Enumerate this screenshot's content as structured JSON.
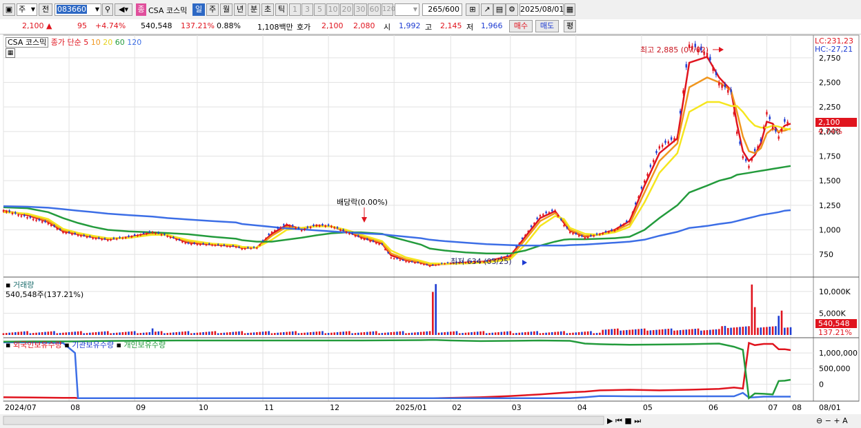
{
  "toolbar": {
    "type_label": "주",
    "prev_label": "전",
    "code": "083660",
    "category_badge": "종",
    "stock_name": "CSA 코스믹",
    "periods": [
      "일",
      "주",
      "월",
      "년",
      "분",
      "초",
      "틱"
    ],
    "active_period": "일",
    "minute_options": [
      "1",
      "3",
      "5",
      "10",
      "20",
      "30",
      "60",
      "120"
    ],
    "count": "265",
    "count_max": "/600",
    "date": "2025/08/01"
  },
  "quote": {
    "price": "2,100",
    "change": "95",
    "change_pct": "+4.74%",
    "volume": "540,548",
    "volume_ratio": "137.21%",
    "turnover": "0.88%",
    "amount": "1,108백만",
    "ask_label": "호가",
    "ask": "2,100",
    "bid": "2,080",
    "open_label": "시",
    "open": "1,992",
    "high_label": "고",
    "high": "2,145",
    "low_label": "저",
    "low": "1,966",
    "buy_label": "매수",
    "sell_label": "매도",
    "eval_label": "평"
  },
  "legend": {
    "stock_label": "CSA 코스믹",
    "ma_label": "종가 단순",
    "ma_periods": [
      {
        "period": "5",
        "color": "#e0141e"
      },
      {
        "period": "10",
        "color": "#f0961e"
      },
      {
        "period": "20",
        "color": "#f5e61e"
      },
      {
        "period": "60",
        "color": "#239b3c"
      },
      {
        "period": "120",
        "color": "#3c6ee6"
      }
    ],
    "volume_label": "거래량",
    "volume_value": "540,548주(137.21%)",
    "holding_labels": [
      "외국인보유수량",
      "기관보유수량",
      "개인보유수량"
    ],
    "lc": "LC:231,23",
    "hc": "HC:-27,21"
  },
  "annotations": {
    "high_text": "최고 2,885 (07/02)",
    "low_text": "최저 634 (03/25)",
    "dividend_text": "배당락(0.00%)",
    "price_tag": "2,100",
    "pct_tag": "4.74%",
    "vol_tag": "540,548",
    "vol_pct_tag": "137.21%"
  },
  "chart_data": [
    {
      "type": "line",
      "title": "CSA 코스믹 일봉",
      "x_ticks": [
        "2024/07",
        "08",
        "09",
        "10",
        "11",
        "12",
        "2025/01",
        "02",
        "03",
        "04",
        "05",
        "06",
        "07",
        "08"
      ],
      "x_tick_right": "08/01",
      "y_ticks": [
        "750",
        "1,000",
        "1,250",
        "1,500",
        "1,750",
        "2,000",
        "2,250",
        "2,500",
        "2,750"
      ],
      "ylim": [
        520,
        2980
      ],
      "x_index": [
        0,
        8,
        15,
        20,
        25,
        30,
        35,
        42,
        50,
        55,
        62,
        70,
        78,
        80,
        85,
        90,
        95,
        100,
        105,
        110,
        115,
        120,
        127,
        130,
        135,
        140,
        143,
        148,
        155,
        162,
        170,
        175,
        180,
        185,
        188,
        190,
        195,
        200,
        205,
        210,
        215,
        220,
        226,
        230,
        236,
        240,
        244,
        246,
        248,
        250,
        252,
        254,
        256,
        258,
        260,
        262,
        264
      ],
      "close": [
        1200,
        1130,
        1070,
        980,
        950,
        920,
        900,
        930,
        980,
        940,
        860,
        850,
        830,
        810,
        820,
        980,
        1060,
        1000,
        1050,
        1040,
        980,
        920,
        850,
        720,
        680,
        660,
        634,
        660,
        670,
        680,
        740,
        950,
        1150,
        1200,
        1050,
        980,
        920,
        960,
        1000,
        1100,
        1500,
        1850,
        1950,
        2885,
        2800,
        2500,
        2400,
        2000,
        1750,
        1650,
        1800,
        1900,
        2200,
        2050,
        1950,
        2100,
        2100
      ],
      "series": [
        {
          "name": "5",
          "values": [
            1195,
            1150,
            1080,
            985,
            955,
            925,
            905,
            925,
            970,
            945,
            870,
            850,
            835,
            815,
            820,
            960,
            1050,
            1010,
            1045,
            1035,
            985,
            925,
            860,
            740,
            690,
            665,
            640,
            655,
            668,
            680,
            735,
            930,
            1120,
            1190,
            1070,
            990,
            930,
            955,
            1000,
            1090,
            1450,
            1780,
            1930,
            2700,
            2760,
            2550,
            2420,
            2080,
            1800,
            1700,
            1760,
            1880,
            2100,
            2080,
            1990,
            2060,
            2080
          ]
        },
        {
          "name": "10",
          "values": [
            1190,
            1160,
            1090,
            995,
            960,
            930,
            910,
            920,
            960,
            950,
            880,
            855,
            840,
            820,
            818,
            940,
            1030,
            1020,
            1040,
            1035,
            990,
            935,
            870,
            760,
            700,
            670,
            648,
            652,
            662,
            676,
            720,
            900,
            1090,
            1170,
            1090,
            1000,
            940,
            950,
            990,
            1060,
            1380,
            1700,
            1880,
            2450,
            2550,
            2500,
            2420,
            2200,
            1950,
            1800,
            1780,
            1830,
            1980,
            2030,
            2000,
            2010,
            2030
          ]
        },
        {
          "name": "20",
          "values": [
            1180,
            1165,
            1110,
            1010,
            970,
            940,
            915,
            918,
            950,
            948,
            895,
            860,
            845,
            828,
            820,
            900,
            1000,
            1020,
            1035,
            1035,
            1000,
            950,
            885,
            790,
            720,
            685,
            660,
            655,
            658,
            668,
            700,
            850,
            1040,
            1140,
            1110,
            1020,
            960,
            950,
            975,
            1030,
            1280,
            1580,
            1780,
            2200,
            2300,
            2300,
            2260,
            2260,
            2200,
            2120,
            2060,
            2040,
            2040,
            2060,
            2050,
            2030,
            2020
          ]
        },
        {
          "name": "60",
          "values": [
            1230,
            1220,
            1180,
            1120,
            1070,
            1030,
            1000,
            985,
            975,
            968,
            955,
            930,
            910,
            895,
            880,
            880,
            900,
            920,
            945,
            965,
            975,
            975,
            960,
            930,
            890,
            850,
            810,
            790,
            770,
            760,
            760,
            790,
            840,
            880,
            900,
            905,
            905,
            910,
            915,
            930,
            1000,
            1120,
            1250,
            1380,
            1450,
            1500,
            1530,
            1560,
            1570,
            1580,
            1590,
            1600,
            1610,
            1620,
            1630,
            1640,
            1650
          ]
        },
        {
          "name": "120",
          "values": [
            1240,
            1235,
            1225,
            1210,
            1195,
            1180,
            1165,
            1150,
            1135,
            1120,
            1105,
            1090,
            1075,
            1060,
            1045,
            1030,
            1015,
            1005,
            995,
            985,
            975,
            965,
            955,
            945,
            930,
            915,
            900,
            885,
            870,
            855,
            845,
            840,
            840,
            840,
            840,
            845,
            850,
            860,
            870,
            880,
            900,
            940,
            980,
            1020,
            1040,
            1060,
            1075,
            1090,
            1105,
            1120,
            1135,
            1150,
            1160,
            1170,
            1180,
            1195,
            1200
          ]
        }
      ]
    },
    {
      "type": "bar",
      "title": "거래량",
      "y_ticks": [
        "5,000K",
        "10,000K"
      ],
      "ylim": [
        0,
        13000
      ],
      "unit": "K",
      "spikes": [
        {
          "x_index": 50,
          "value": 1500,
          "color": "blue"
        },
        {
          "x_index": 144,
          "value": 9900,
          "color": "red"
        },
        {
          "x_index": 145,
          "value": 11700,
          "color": "blue"
        },
        {
          "x_index": 251,
          "value": 11600,
          "color": "red"
        },
        {
          "x_index": 252,
          "value": 6400,
          "color": "red"
        },
        {
          "x_index": 260,
          "value": 4400,
          "color": "blue"
        },
        {
          "x_index": 261,
          "value": 5600,
          "color": "red"
        }
      ],
      "baseline_value": 400
    },
    {
      "type": "line",
      "title": "보유수량",
      "y_ticks": [
        "0",
        "500,000",
        "1,000,000"
      ],
      "ylim": [
        -500000,
        1400000
      ],
      "x_index": [
        0,
        10,
        20,
        24,
        25,
        30,
        40,
        60,
        80,
        100,
        120,
        140,
        144,
        150,
        160,
        170,
        180,
        190,
        195,
        200,
        210,
        220,
        230,
        240,
        245,
        248,
        250,
        252,
        255,
        258,
        260,
        262,
        264
      ],
      "series": [
        {
          "name": "외국인보유수량",
          "values": [
            -420000,
            -430000,
            -440000,
            -440000,
            -450000,
            -450000,
            -450000,
            -450000,
            -450000,
            -450000,
            -450000,
            -450000,
            -450000,
            -440000,
            -420000,
            -380000,
            -330000,
            -260000,
            -240000,
            -200000,
            -180000,
            -200000,
            -180000,
            -150000,
            -110000,
            -140000,
            1320000,
            1250000,
            1290000,
            1290000,
            1120000,
            1120000,
            1090000
          ]
        },
        {
          "name": "기관보유수량",
          "values": [
            1340000,
            1340000,
            1320000,
            1000000,
            -450000,
            -450000,
            -450000,
            -450000,
            -450000,
            -450000,
            -450000,
            -450000,
            -450000,
            -450000,
            -450000,
            -450000,
            -450000,
            -450000,
            -420000,
            -380000,
            -390000,
            -390000,
            -390000,
            -390000,
            -390000,
            -280000,
            -430000,
            -420000,
            -400000,
            -400000,
            -400000,
            -400000,
            -400000
          ]
        },
        {
          "name": "개인보유수량",
          "values": [
            1360000,
            1370000,
            1370000,
            1370000,
            1370000,
            1380000,
            1390000,
            1400000,
            1400000,
            1400000,
            1400000,
            1410000,
            1420000,
            1400000,
            1380000,
            1390000,
            1400000,
            1390000,
            1300000,
            1280000,
            1260000,
            1270000,
            1280000,
            1300000,
            1200000,
            1100000,
            -450000,
            -300000,
            -310000,
            -330000,
            100000,
            110000,
            140000
          ]
        }
      ]
    }
  ]
}
